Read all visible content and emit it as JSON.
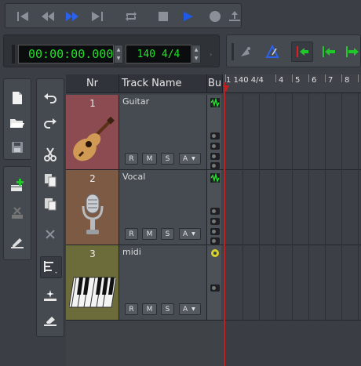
{
  "transport": {
    "buttons": [
      "rewind-to-start",
      "rewind",
      "fast-forward",
      "forward-to-end",
      "loop",
      "stop",
      "play",
      "record",
      "punch"
    ]
  },
  "time": {
    "position": "00:00:00.000",
    "tempo_signature": "140 4/4"
  },
  "tracklist": {
    "header_nr": "Nr",
    "header_name": "Track Name",
    "header_bus": "Bu",
    "tracks": [
      {
        "nr": "1",
        "name": "Guitar",
        "color": "#8c4b51",
        "icon": "acoustic-guitar-icon",
        "r": "R",
        "m": "M",
        "s": "S",
        "a": "A",
        "bus_icon": "audio-wave-icon"
      },
      {
        "nr": "2",
        "name": "Vocal",
        "color": "#7d5a43",
        "icon": "microphone-icon",
        "r": "R",
        "m": "M",
        "s": "S",
        "a": "A",
        "bus_icon": "audio-wave-icon"
      },
      {
        "nr": "3",
        "name": "midi",
        "color": "#6c6c3b",
        "icon": "piano-keys-icon",
        "r": "R",
        "m": "M",
        "s": "S",
        "a": "A",
        "bus_icon": "midi-gear-icon"
      }
    ]
  },
  "ruler": {
    "start_label": "1 140 4/4",
    "bars": [
      "4",
      "5",
      "6",
      "7",
      "8"
    ]
  },
  "colors": {
    "lcd_text": "#22e029",
    "play_blue": "#1d5ae6",
    "cursor_red": "#c41f1f"
  }
}
